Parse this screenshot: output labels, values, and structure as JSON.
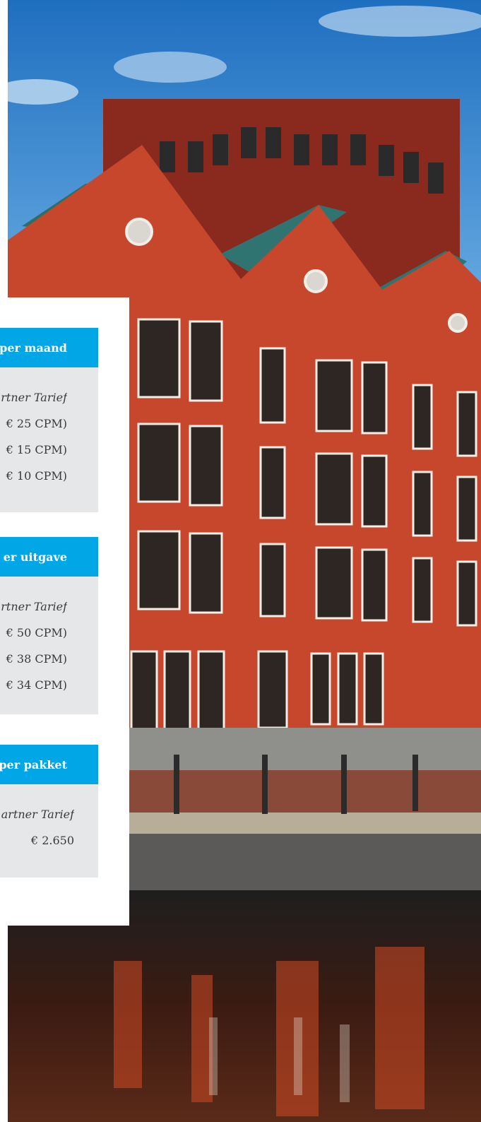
{
  "sections": [
    {
      "header": "per maand",
      "subheader": "rtner Tarief",
      "rows": [
        "€ 25 CPM)",
        "€ 15 CPM)",
        "€ 10 CPM)"
      ]
    },
    {
      "header": "er uitgave",
      "subheader": "rtner Tarief",
      "rows": [
        "€ 50 CPM)",
        "€ 38 CPM)",
        "€ 34 CPM)"
      ]
    },
    {
      "header": "per pakket",
      "subheader": "artner Tarief",
      "rows": [
        "€ 2.650"
      ]
    }
  ],
  "colors": {
    "accent": "#00a6e6",
    "panel_bg": "#e6e7e8",
    "brick": "#c6472b",
    "sky": "#2b7fc9"
  }
}
